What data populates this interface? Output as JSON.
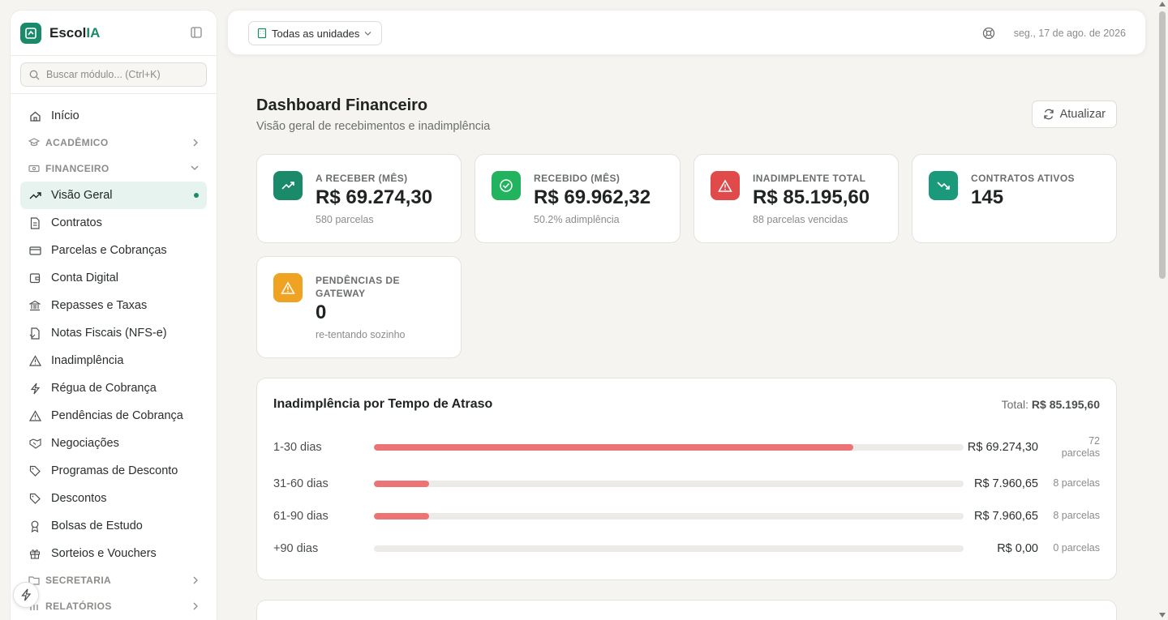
{
  "app": {
    "name_prefix": "Escol",
    "name_accent": "IA"
  },
  "sidebar": {
    "search_placeholder": "Buscar módulo... (Ctrl+K)",
    "home": {
      "label": "Início",
      "icon": "home-icon"
    },
    "sections": {
      "academico": "ACADÊMICO",
      "financeiro": "FINANCEIRO",
      "secretaria": "SECRETARIA",
      "relatorios": "RELATÓRIOS"
    },
    "items": [
      {
        "label": "Visão Geral",
        "icon": "trending-up-icon",
        "active": true
      },
      {
        "label": "Contratos",
        "icon": "document-icon"
      },
      {
        "label": "Parcelas e Cobranças",
        "icon": "credit-card-icon"
      },
      {
        "label": "Conta Digital",
        "icon": "wallet-icon"
      },
      {
        "label": "Repasses e Taxas",
        "icon": "bank-icon"
      },
      {
        "label": "Notas Fiscais (NFS-e)",
        "icon": "receipt-icon"
      },
      {
        "label": "Inadimplência",
        "icon": "warning-icon"
      },
      {
        "label": "Régua de Cobrança",
        "icon": "lightning-icon"
      },
      {
        "label": "Pendências de Cobrança",
        "icon": "warning-icon"
      },
      {
        "label": "Negociações",
        "icon": "handshake-icon"
      },
      {
        "label": "Programas de Desconto",
        "icon": "tag-icon"
      },
      {
        "label": "Descontos",
        "icon": "tag-icon"
      },
      {
        "label": "Bolsas de Estudo",
        "icon": "award-icon"
      },
      {
        "label": "Sorteios e Vouchers",
        "icon": "gift-icon"
      }
    ]
  },
  "topbar": {
    "unit_selector": "Todas as unidades",
    "date": "seg., 17 de ago. de 2026"
  },
  "page": {
    "title": "Dashboard Financeiro",
    "subtitle": "Visão geral de recebimentos e inadimplência",
    "refresh_label": "Atualizar"
  },
  "kpis": {
    "a_receber": {
      "label": "A RECEBER (MÊS)",
      "value": "R$ 69.274,30",
      "sub": "580 parcelas",
      "color": "#1a8a6b"
    },
    "recebido": {
      "label": "RECEBIDO (MÊS)",
      "value": "R$ 69.962,32",
      "sub": "50.2% adimplência",
      "color": "#22b35e"
    },
    "inadimplente": {
      "label": "INADIMPLENTE TOTAL",
      "value": "R$ 85.195,60",
      "sub": "88 parcelas vencidas",
      "color": "#e04a4a"
    },
    "contratos": {
      "label": "CONTRATOS ATIVOS",
      "value": "145",
      "color": "#1a9a7b"
    },
    "pendencias": {
      "label": "PENDÊNCIAS DE GATEWAY",
      "value": "0",
      "sub": "re-tentando sozinho",
      "color": "#f0a323"
    }
  },
  "aging": {
    "title": "Inadimplência por Tempo de Atraso",
    "total_label": "Total:",
    "total_value": "R$ 85.195,60",
    "bar_color": "#ec7474",
    "rows": [
      {
        "label": "1-30 dias",
        "amount": "R$ 69.274,30",
        "count": "72 parcelas",
        "fraction": 0.813
      },
      {
        "label": "31-60 dias",
        "amount": "R$ 7.960,65",
        "count": "8 parcelas",
        "fraction": 0.0934
      },
      {
        "label": "61-90 dias",
        "amount": "R$ 7.960,65",
        "count": "8 parcelas",
        "fraction": 0.0934
      },
      {
        "label": "+90 dias",
        "amount": "R$ 0,00",
        "count": "0 parcelas",
        "fraction": 0
      }
    ]
  }
}
